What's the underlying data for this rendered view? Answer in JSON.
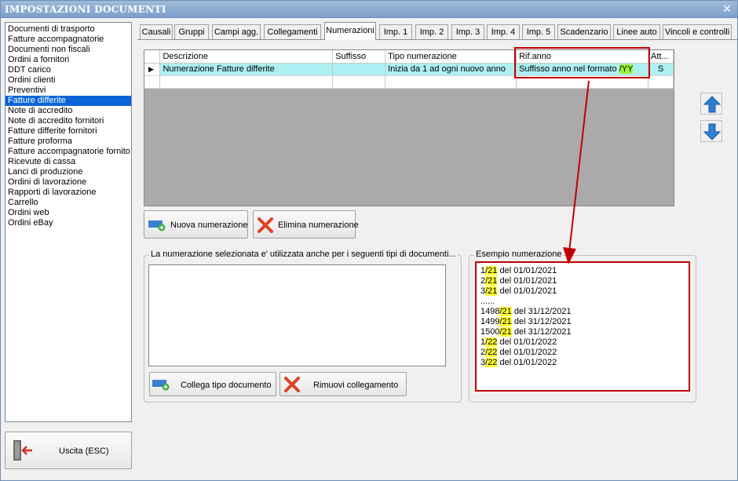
{
  "window": {
    "title": "IMPOSTAZIONI DOCUMENTI",
    "close_glyph": "✕"
  },
  "document_types": [
    {
      "label": "Documenti di trasporto",
      "selected": false
    },
    {
      "label": "Fatture accompagnatorie",
      "selected": false
    },
    {
      "label": "Documenti non fiscali",
      "selected": false
    },
    {
      "label": "Ordini a fornitori",
      "selected": false
    },
    {
      "label": "DDT carico",
      "selected": false
    },
    {
      "label": "Ordini clienti",
      "selected": false
    },
    {
      "label": "Preventivi",
      "selected": false
    },
    {
      "label": "Fatture differite",
      "selected": true
    },
    {
      "label": "Note di accredito",
      "selected": false
    },
    {
      "label": "Note di accredito fornitori",
      "selected": false
    },
    {
      "label": "Fatture differite fornitori",
      "selected": false
    },
    {
      "label": "Fatture proforma",
      "selected": false
    },
    {
      "label": "Fatture accompagnatorie fornito",
      "selected": false
    },
    {
      "label": "Ricevute di cassa",
      "selected": false
    },
    {
      "label": "Lanci di produzione",
      "selected": false
    },
    {
      "label": "Ordini di lavorazione",
      "selected": false
    },
    {
      "label": "Rapporti di lavorazione",
      "selected": false
    },
    {
      "label": "Carrello",
      "selected": false
    },
    {
      "label": "Ordini web",
      "selected": false
    },
    {
      "label": "Ordini eBay",
      "selected": false
    }
  ],
  "exit_button": {
    "label": "Uscita (ESC)",
    "icon": "exit-door-icon"
  },
  "tabs": [
    {
      "label": "Causali",
      "active": false
    },
    {
      "label": "Gruppi",
      "active": false
    },
    {
      "label": "Campi agg.",
      "active": false
    },
    {
      "label": "Collegamenti",
      "active": false
    },
    {
      "label": "Numerazioni",
      "active": true
    },
    {
      "label": "Imp. 1",
      "active": false
    },
    {
      "label": "Imp. 2",
      "active": false
    },
    {
      "label": "Imp. 3",
      "active": false
    },
    {
      "label": "Imp. 4",
      "active": false
    },
    {
      "label": "Imp. 5",
      "active": false
    },
    {
      "label": "Scadenzario",
      "active": false
    },
    {
      "label": "Linee auto",
      "active": false
    },
    {
      "label": "Vincoli e controlli",
      "active": false
    }
  ],
  "numbering_grid": {
    "columns": [
      "Descrizione",
      "Suffisso",
      "Tipo numerazione",
      "Rif.anno",
      "Att..."
    ],
    "row_indicator": "▶",
    "rows": [
      {
        "descrizione": "Numerazione Fatture differite",
        "suffisso": "",
        "tipo_numerazione": "Inizia da 1 ad ogni nuovo anno",
        "rif_anno_text": "Suffisso anno nel formato ",
        "rif_anno_format": "/YY",
        "attivo": "S"
      }
    ]
  },
  "side_buttons": {
    "up_icon": "arrow-up-icon",
    "down_icon": "arrow-down-icon"
  },
  "buttons": {
    "new_numbering": "Nuova numerazione",
    "delete_numbering": "Elimina numerazione",
    "link_doc_type": "Collega tipo documento",
    "remove_link": "Rimuovi collegamento"
  },
  "linked_group": {
    "legend": "La numerazione selezionata e' utilizzata anche per i seguenti tipi di documenti..."
  },
  "example_group": {
    "legend": "Esempio numerazione",
    "lines": [
      {
        "num": "1",
        "suffix": "/21",
        "rest": " del 01/01/2021"
      },
      {
        "num": "2",
        "suffix": "/21",
        "rest": " del 01/01/2021"
      },
      {
        "num": "3",
        "suffix": "/21",
        "rest": " del 01/01/2021"
      },
      {
        "num": "......",
        "suffix": "",
        "rest": ""
      },
      {
        "num": "1498",
        "suffix": "/21",
        "rest": " del 31/12/2021"
      },
      {
        "num": "1499",
        "suffix": "/21",
        "rest": " del 31/12/2021"
      },
      {
        "num": "1500",
        "suffix": "/21",
        "rest": " del 31/12/2021"
      },
      {
        "num": "1",
        "suffix": "/22",
        "rest": " del 01/01/2022"
      },
      {
        "num": "2",
        "suffix": "/22",
        "rest": " del 01/01/2022"
      },
      {
        "num": "3",
        "suffix": "/22",
        "rest": " del 01/01/2022"
      }
    ]
  },
  "colors": {
    "selection": "#0a64d7",
    "row_selected": "#aef0f2",
    "highlight_yellow": "#ffff33",
    "highlight_green": "#9df23a",
    "annotation_red": "#c00000"
  }
}
